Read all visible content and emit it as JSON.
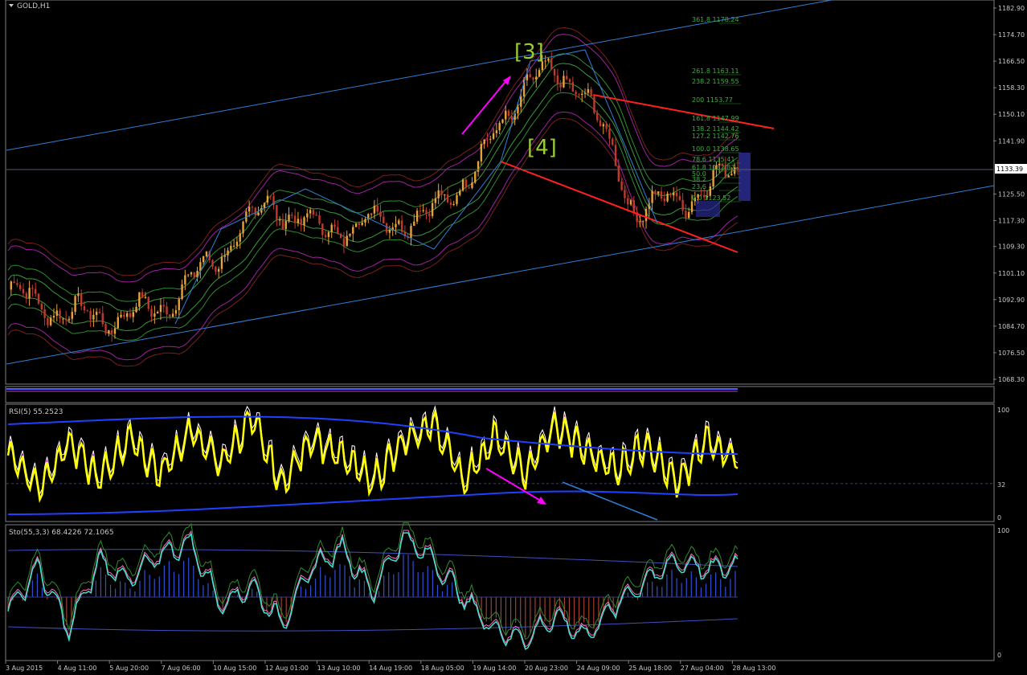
{
  "window": {
    "title": "GOLD,H1"
  },
  "colors": {
    "background": "#000000",
    "bull_candle": "#e8a23a",
    "bear_candle": "#c0392b",
    "trendline": "#2f7fd8",
    "red_line": "#ff2020",
    "magenta": "#ff00ff",
    "rsi": "#ffff00",
    "stoch_main": "#40e0d0",
    "stoch_signal": "#ff69b4",
    "histogram_pos": "#3050d0",
    "histogram_neg": "#a04030",
    "fib_text": "#3fae3f",
    "wave_label": "#9acd32"
  },
  "price_axis": {
    "ticks": [
      "1182.90",
      "1174.70",
      "1166.50",
      "1158.30",
      "1150.10",
      "1141.90",
      "1133.39",
      "1125.50",
      "1117.30",
      "1109.30",
      "1101.10",
      "1092.90",
      "1084.70",
      "1076.50",
      "1068.30"
    ]
  },
  "current_price": "1133.39",
  "time_axis": [
    "3 Aug 2015",
    "4 Aug 11:00",
    "5 Aug 20:00",
    "7 Aug 06:00",
    "10 Aug 15:00",
    "12 Aug 01:00",
    "13 Aug 10:00",
    "14 Aug 19:00",
    "18 Aug 05:00",
    "19 Aug 14:00",
    "20 Aug 23:00",
    "24 Aug 09:00",
    "25 Aug 18:00",
    "27 Aug 04:00",
    "28 Aug 13:00"
  ],
  "waves": {
    "w3": "[3]",
    "w4": "[4]"
  },
  "fib_levels": [
    {
      "ratio": "361.8",
      "price": "1178.24"
    },
    {
      "ratio": "261.8",
      "price": "1163.11"
    },
    {
      "ratio": "238.2",
      "price": "1159.55"
    },
    {
      "ratio": "200",
      "price": "1153.77"
    },
    {
      "ratio": "161.8",
      "price": "1147.99"
    },
    {
      "ratio": "138.2",
      "price": "1144.42"
    },
    {
      "ratio": "127.2",
      "price": "1142.76"
    },
    {
      "ratio": "100.0",
      "price": "1138.65"
    },
    {
      "ratio": "78.6",
      "price": "1135.41"
    },
    {
      "ratio": "61.8",
      "price": "1132.87"
    },
    {
      "ratio": "50.0",
      "price": ""
    },
    {
      "ratio": "38.2",
      "price": ""
    },
    {
      "ratio": "23.6",
      "price": ""
    },
    {
      "ratio": "0.0",
      "price": "1123.52"
    }
  ],
  "rsi_panel": {
    "label": "RSI(5) 55.2523",
    "levels": [
      "100",
      "32",
      "0"
    ]
  },
  "stoch_panel": {
    "label": "Sto(55,3,3) 68.4226 72.1065",
    "levels": [
      "100",
      "0"
    ]
  },
  "chart_data": {
    "type": "line",
    "title": "GOLD,H1",
    "x_range": [
      "3 Aug 2015",
      "28 Aug 13:00"
    ],
    "ylim": [
      1068.3,
      1182.9
    ],
    "series": [
      {
        "name": "GOLD,H1",
        "x": [
          "3 Aug 2015",
          "4 Aug 11:00",
          "5 Aug 20:00",
          "7 Aug 06:00",
          "10 Aug 15:00",
          "12 Aug 01:00",
          "13 Aug 10:00",
          "14 Aug 19:00",
          "18 Aug 05:00",
          "19 Aug 14:00",
          "20 Aug 23:00",
          "24 Aug 09:00",
          "25 Aug 18:00",
          "27 Aug 04:00",
          "28 Aug 13:00"
        ],
        "values": [
          1096.0,
          1089.0,
          1087.0,
          1091.0,
          1106.0,
          1123.0,
          1114.0,
          1117.0,
          1118.0,
          1134.0,
          1162.0,
          1160.0,
          1121.0,
          1124.0,
          1133.4
        ]
      }
    ],
    "rsi": {
      "values": [
        62,
        28,
        70,
        35,
        75,
        40,
        80,
        50,
        92,
        30,
        75,
        55,
        35,
        68,
        88,
        35,
        75,
        40,
        85,
        62,
        45,
        70,
        30,
        72,
        55
      ]
    },
    "stoch": {
      "values": [
        35,
        70,
        20,
        75,
        60,
        80,
        90,
        40,
        55,
        25,
        70,
        85,
        50,
        95,
        75,
        45,
        20,
        12,
        30,
        15,
        40,
        60,
        75,
        68,
        72
      ]
    }
  }
}
